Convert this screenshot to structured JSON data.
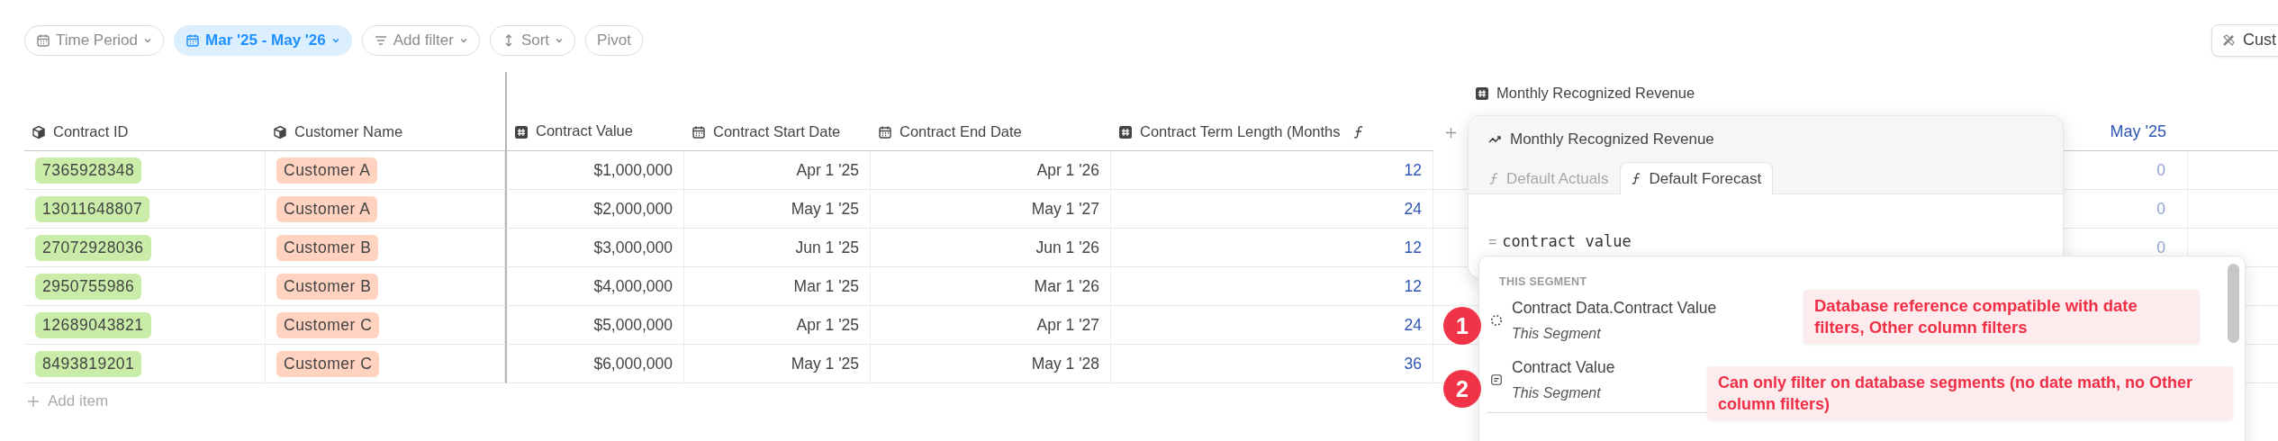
{
  "toolbar": {
    "filters": [
      {
        "label": "Time Period",
        "kind": "calendar",
        "active": false
      },
      {
        "label": "Mar '25 - May '26",
        "kind": "calendar",
        "active": true
      },
      {
        "label": "Add filter",
        "kind": "filter",
        "active": false
      },
      {
        "label": "Sort",
        "kind": "sort",
        "active": false
      },
      {
        "label": "Pivot",
        "kind": "plain",
        "active": false
      }
    ],
    "right_button": {
      "label": "Cust"
    }
  },
  "table": {
    "columns": [
      {
        "label": "Contract ID",
        "kind": "id"
      },
      {
        "label": "Customer Name",
        "kind": "customer"
      },
      {
        "label": "Contract Value",
        "kind": "currency"
      },
      {
        "label": "Contract Start Date",
        "kind": "date"
      },
      {
        "label": "Contract End Date",
        "kind": "date"
      },
      {
        "label": "Contract Term Length (Months",
        "kind": "formula"
      }
    ],
    "rows": [
      {
        "cells": [
          "7365928348",
          "Customer A",
          "$1,000,000",
          "Apr 1 '25",
          "Apr 1 '26",
          "12"
        ]
      },
      {
        "cells": [
          "13011648807",
          "Customer A",
          "$2,000,000",
          "May 1 '25",
          "May 1 '27",
          "24"
        ]
      },
      {
        "cells": [
          "27072928036",
          "Customer B",
          "$3,000,000",
          "Jun 1 '25",
          "Jun 1 '26",
          "12"
        ]
      },
      {
        "cells": [
          "2950755986",
          "Customer B",
          "$4,000,000",
          "Mar 1 '25",
          "Mar 1 '26",
          "12"
        ]
      },
      {
        "cells": [
          "12689043821",
          "Customer C",
          "$5,000,000",
          "Apr 1 '25",
          "Apr 1 '27",
          "24"
        ]
      },
      {
        "cells": [
          "8493819201",
          "Customer C",
          "$6,000,000",
          "May 1 '25",
          "May 1 '28",
          "36"
        ]
      }
    ],
    "add_item": "Add item"
  },
  "revenue": {
    "group_label": "Monthly Recognized Revenue",
    "month": "May '25",
    "values": [
      "0",
      "0",
      "0"
    ]
  },
  "formula_popup": {
    "title": "Monthly Recognized Revenue",
    "tabs": [
      {
        "label": "Default Actuals",
        "selected": false
      },
      {
        "label": "Default Forecast",
        "selected": true
      }
    ],
    "equals": "=",
    "formula": "contract value"
  },
  "suggestions": {
    "section": "THIS SEGMENT",
    "items": [
      {
        "name": "Contract Data.Contract Value",
        "subtitle": "This Segment",
        "kind": "database"
      },
      {
        "name": "Contract Value",
        "subtitle": "This Segment",
        "kind": "segment"
      }
    ]
  },
  "annotations": [
    {
      "number": "1",
      "text": "Database reference compatible with date filters, Other column filters"
    },
    {
      "number": "2",
      "text": "Can only filter on database segments (no date math, no Other column filters)"
    }
  ]
}
